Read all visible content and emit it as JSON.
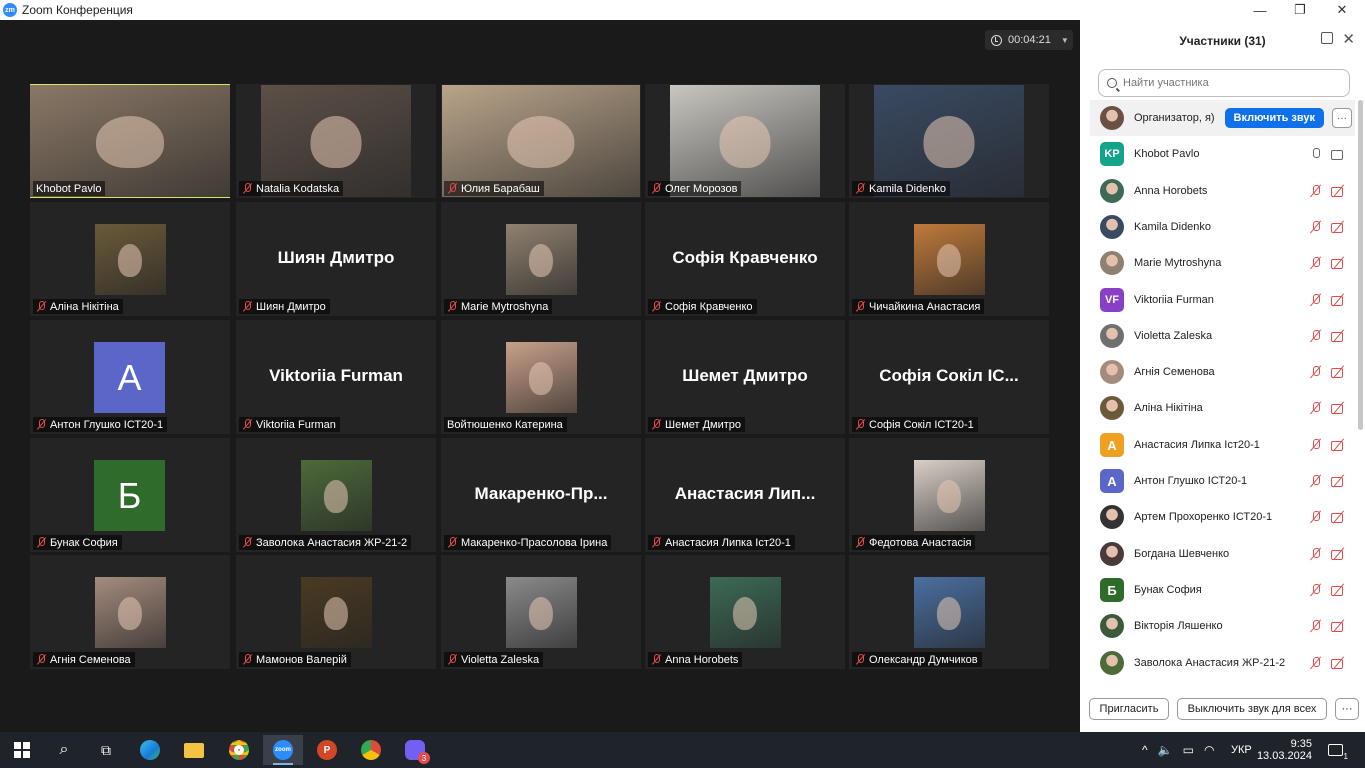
{
  "window": {
    "app_title": "Zoom Конференция",
    "logo_text": "zm",
    "minimize": "—",
    "maximize": "❐",
    "close": "✕"
  },
  "meeting": {
    "timer": "00:04:21"
  },
  "tiles": [
    {
      "name": "Khobot Pavlo",
      "kind": "photo",
      "muted": false,
      "active": true,
      "color": "#8a7866"
    },
    {
      "name": "Natalia Kodatska",
      "kind": "photo",
      "muted": true,
      "color": "#5c5048"
    },
    {
      "name": "Юлия Барабаш",
      "kind": "photo",
      "muted": true,
      "color": "#b9a48a"
    },
    {
      "name": "Олег Морозов",
      "kind": "photo",
      "muted": true,
      "color": "#c9c6c0"
    },
    {
      "name": "Kamila Didenko",
      "kind": "photo",
      "muted": true,
      "color": "#3a4a63"
    },
    {
      "name": "Аліна Нікітіна",
      "kind": "photo",
      "muted": true,
      "color": "#6a5a3a"
    },
    {
      "name": "Шиян Дмитро",
      "kind": "text",
      "muted": true
    },
    {
      "name": "Marie Mytroshyna",
      "kind": "photo",
      "muted": true,
      "color": "#8f8170"
    },
    {
      "name": "Софія Кравченко",
      "kind": "text",
      "muted": true
    },
    {
      "name": "Чичайкина Анастасия",
      "kind": "photo",
      "muted": true,
      "color": "#c07a3a"
    },
    {
      "name": "Антон Глушко ІСТ20-1",
      "kind": "letter",
      "letter": "A",
      "muted": true,
      "color": "#5a67c9"
    },
    {
      "name": "Viktoriia Furman",
      "kind": "text",
      "muted": true
    },
    {
      "name": "Войтюшенко Катерина",
      "kind": "photo",
      "muted": false,
      "color": "#c9a08a"
    },
    {
      "name": "Шемет Дмитро",
      "kind": "text",
      "muted": true
    },
    {
      "name": "Софія Сокіл  ІСТ20-1",
      "display": "Софія Сокіл  ІС...",
      "kind": "text",
      "muted": true
    },
    {
      "name": "Бунак София",
      "kind": "letter",
      "letter": "Б",
      "muted": true,
      "color": "#2f6b2a"
    },
    {
      "name": "Заволока Анастасия ЖР-21-2",
      "kind": "photo",
      "muted": true,
      "color": "#4d6a3a"
    },
    {
      "name": "Макаренко-Прасолова Ірина",
      "display": "Макаренко-Пр...",
      "kind": "text",
      "muted": true
    },
    {
      "name": "Анастасия Липка Іст20-1",
      "display": "Анастасия  Лип...",
      "kind": "text",
      "muted": true
    },
    {
      "name": "Федотова Анастасія",
      "kind": "photo",
      "muted": true,
      "color": "#d9cfc7"
    },
    {
      "name": "Агнія Семенова",
      "kind": "photo",
      "muted": true,
      "color": "#a58b7e"
    },
    {
      "name": "Мамонов Валерій",
      "kind": "photo",
      "muted": true,
      "color": "#4a3a22"
    },
    {
      "name": "Violetta Zaleska",
      "kind": "photo",
      "muted": true,
      "color": "#8a8a8a"
    },
    {
      "name": "Anna Horobets",
      "kind": "photo",
      "muted": true,
      "color": "#3c6a55"
    },
    {
      "name": "Олександр Думчиков",
      "kind": "photo",
      "muted": true,
      "color": "#4a6fa0"
    }
  ],
  "panel": {
    "title": "Участники (31)",
    "search_placeholder": "Найти участника",
    "unmute_label": "Включить звук",
    "more_label": "···",
    "invite_label": "Пригласить",
    "mute_all_label": "Выключить звук для всех",
    "participants": [
      {
        "name": "Организатор, я)",
        "avatar_type": "photo",
        "color": "#6b5044",
        "me": true
      },
      {
        "name": "Khobot Pavlo",
        "avatar_type": "initials",
        "initials": "KP",
        "color": "#14a38b",
        "mic": "on",
        "cam": "on"
      },
      {
        "name": "Anna Horobets",
        "avatar_type": "photo",
        "color": "#3c6a55",
        "mic": "off",
        "cam": "off"
      },
      {
        "name": "Kamila Didenko",
        "avatar_type": "photo",
        "color": "#3a4a63",
        "mic": "off",
        "cam": "off"
      },
      {
        "name": "Marie Mytroshyna",
        "avatar_type": "photo",
        "color": "#8f8170",
        "mic": "off",
        "cam": "off"
      },
      {
        "name": "Viktoriia Furman",
        "avatar_type": "initials",
        "initials": "VF",
        "color": "#8a3fc7",
        "mic": "off",
        "cam": "off"
      },
      {
        "name": "Violetta Zaleska",
        "avatar_type": "photo",
        "color": "#6f6f6f",
        "mic": "off",
        "cam": "off"
      },
      {
        "name": "Агнія Семенова",
        "avatar_type": "photo",
        "color": "#a58b7e",
        "mic": "off",
        "cam": "off"
      },
      {
        "name": "Аліна Нікітіна",
        "avatar_type": "photo",
        "color": "#6a5a3a",
        "mic": "off",
        "cam": "off"
      },
      {
        "name": "Анастасия Липка Іст20-1",
        "avatar_type": "initials",
        "initials": "A",
        "color": "#f0a020",
        "mic": "off",
        "cam": "off"
      },
      {
        "name": "Антон Глушко ІСТ20-1",
        "avatar_type": "initials",
        "initials": "A",
        "color": "#5a67c9",
        "mic": "off",
        "cam": "off"
      },
      {
        "name": "Артем Прохоренко ІСТ20-1",
        "avatar_type": "photo",
        "color": "#333333",
        "mic": "off",
        "cam": "off"
      },
      {
        "name": "Богдана Шевченко",
        "avatar_type": "photo",
        "color": "#4a3a3a",
        "mic": "off",
        "cam": "off"
      },
      {
        "name": "Бунак София",
        "avatar_type": "initials",
        "initials": "Б",
        "color": "#2f6b2a",
        "mic": "off",
        "cam": "off"
      },
      {
        "name": "Вікторія Ляшенко",
        "avatar_type": "photo",
        "color": "#3a5a3a",
        "mic": "off",
        "cam": "off"
      },
      {
        "name": "Заволока Анастасия ЖР-21-2",
        "avatar_type": "photo",
        "color": "#4d6a3a",
        "mic": "off",
        "cam": "off"
      }
    ]
  },
  "taskbar": {
    "apps": [
      "windows-start",
      "search",
      "task-view",
      "edge",
      "file-explorer",
      "chrome",
      "zoom",
      "powerpoint",
      "chrome-profile",
      "viber"
    ],
    "viber_badge": "3",
    "lang": "УКР",
    "time": "9:35",
    "date": "13.03.2024",
    "notifications": "1"
  }
}
